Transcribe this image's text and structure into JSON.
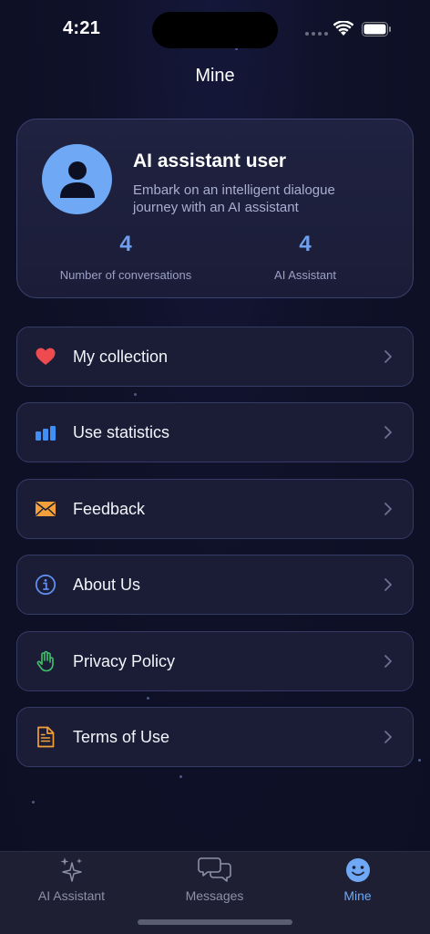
{
  "status": {
    "time": "4:21"
  },
  "header": {
    "title": "Mine"
  },
  "profile": {
    "name": "AI assistant user",
    "description": "Embark on an intelligent dialogue journey with an AI assistant",
    "stats": [
      {
        "value": "4",
        "label": "Number of conversations"
      },
      {
        "value": "4",
        "label": "AI Assistant"
      }
    ]
  },
  "menu": {
    "items": [
      {
        "label": "My collection",
        "icon": "heart-icon"
      },
      {
        "label": "Use statistics",
        "icon": "bar-chart-icon"
      },
      {
        "label": "Feedback",
        "icon": "envelope-icon"
      },
      {
        "label": "About Us",
        "icon": "info-icon"
      },
      {
        "label": "Privacy Policy",
        "icon": "hand-icon"
      },
      {
        "label": "Terms of Use",
        "icon": "document-icon"
      }
    ]
  },
  "tabbar": {
    "tabs": [
      {
        "label": "AI Assistant",
        "icon": "sparkles-icon"
      },
      {
        "label": "Messages",
        "icon": "chat-bubbles-icon"
      },
      {
        "label": "Mine",
        "icon": "smiley-icon",
        "active": true
      }
    ]
  },
  "colors": {
    "accent": "#6fa8f5",
    "background": "#0f1024",
    "card": "#1b1d36"
  }
}
